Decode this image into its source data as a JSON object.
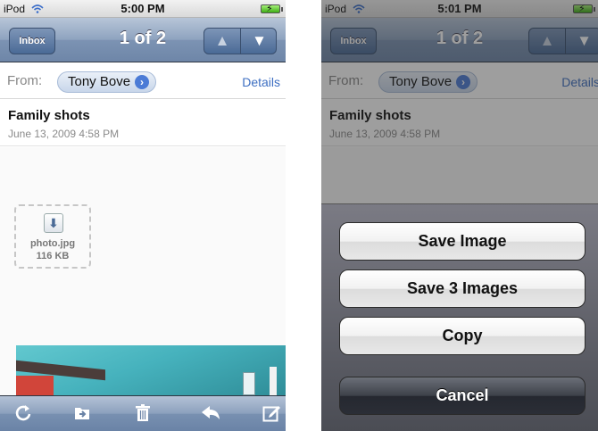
{
  "left_screen": {
    "status": {
      "carrier": "iPod",
      "time": "5:00 PM"
    },
    "nav": {
      "back_label": "Inbox",
      "title": "1 of 2",
      "up_glyph": "▲",
      "down_glyph": "▼"
    },
    "header": {
      "from_label": "From:",
      "sender": "Tony Bove",
      "details": "Details"
    },
    "message": {
      "subject": "Family shots",
      "date": "June 13, 2009 4:58 PM"
    },
    "attachment": {
      "icon": "download-arrow-icon",
      "name": "photo.jpg",
      "size": "116 KB"
    },
    "toolbar": {
      "icons": [
        "refresh-icon",
        "move-folder-icon",
        "trash-icon",
        "reply-icon",
        "compose-icon"
      ]
    }
  },
  "right_screen": {
    "status": {
      "carrier": "iPod",
      "time": "5:01 PM"
    },
    "nav": {
      "back_label": "Inbox",
      "title": "1 of 2",
      "up_glyph": "▲",
      "down_glyph": "▼"
    },
    "header": {
      "from_label": "From:",
      "sender": "Tony Bove",
      "details": "Details"
    },
    "message": {
      "subject": "Family shots",
      "date": "June 13, 2009 4:58 PM"
    },
    "action_sheet": {
      "save_image": "Save Image",
      "save_images": "Save 3 Images",
      "copy": "Copy",
      "cancel": "Cancel"
    }
  },
  "colors": {
    "nav_blue": "#7c93b3",
    "link_blue": "#3e6fc2",
    "chip_blue": "#4b7bd6"
  }
}
